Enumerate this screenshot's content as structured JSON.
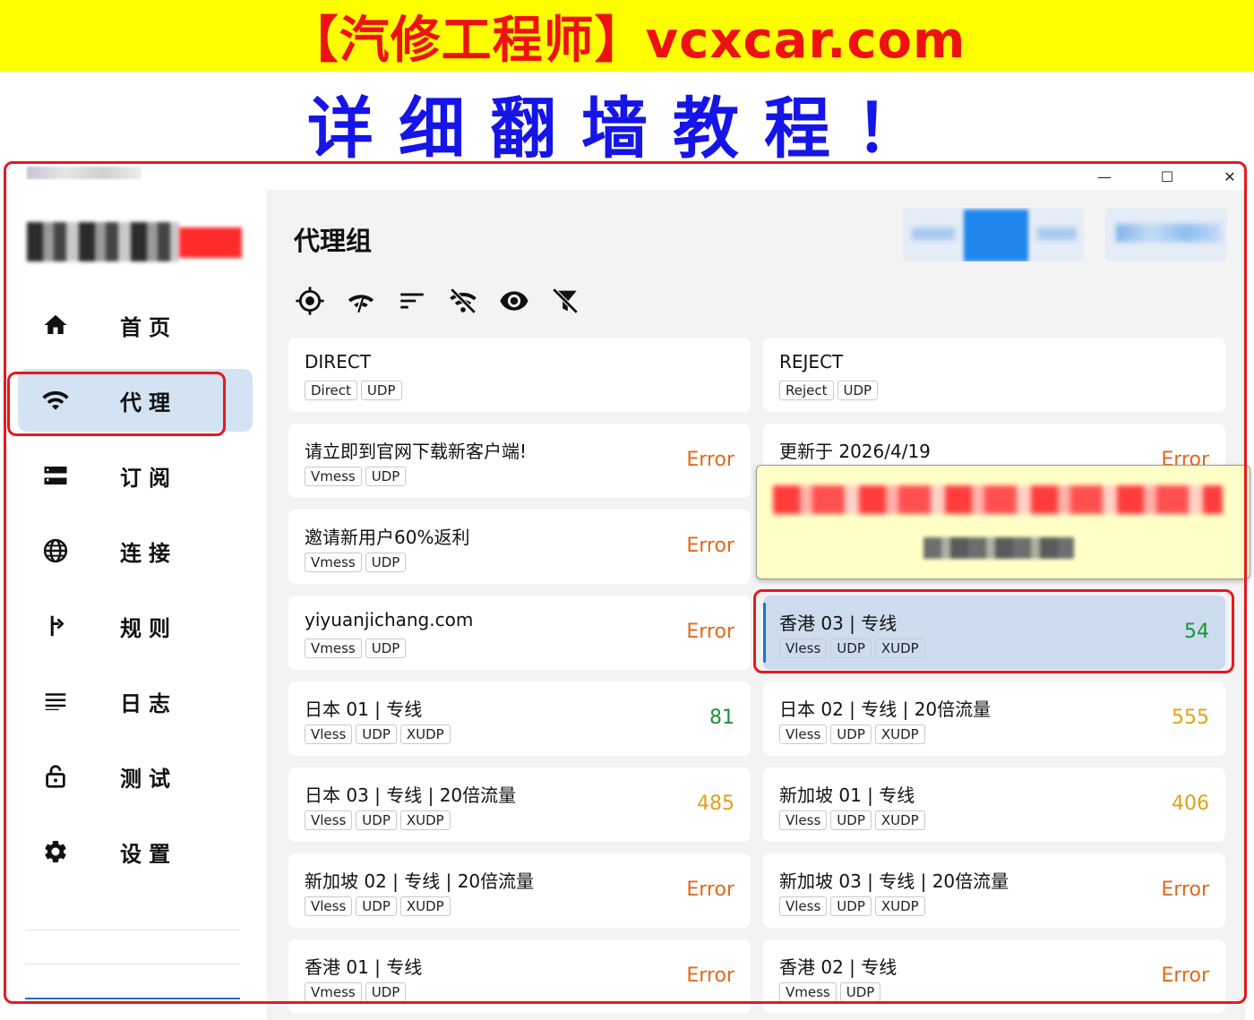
{
  "banner": {
    "title": "【汽修工程师】vcxcar.com",
    "subtitle": "详细翻墙教程！"
  },
  "window": {
    "minimize_glyph": "—",
    "maximize_glyph": "☐",
    "close_glyph": "✕"
  },
  "sidebar": {
    "items": [
      {
        "label": "首页",
        "icon": "home-icon"
      },
      {
        "label": "代理",
        "icon": "wifi-icon"
      },
      {
        "label": "订阅",
        "icon": "storage-icon"
      },
      {
        "label": "连接",
        "icon": "globe-icon"
      },
      {
        "label": "规则",
        "icon": "fork-arrow-icon"
      },
      {
        "label": "日志",
        "icon": "lines-icon"
      },
      {
        "label": "测试",
        "icon": "lock-icon"
      },
      {
        "label": "设置",
        "icon": "gear-icon"
      }
    ],
    "active_index": 1
  },
  "main": {
    "title": "代理组",
    "toolbar": [
      "locate-icon",
      "speed-test-icon",
      "sort-icon",
      "wifi-off-icon",
      "eye-icon",
      "filter-off-icon"
    ]
  },
  "proxies": [
    {
      "name": "DIRECT",
      "tags": [
        "Direct",
        "UDP"
      ],
      "delay": ""
    },
    {
      "name": "REJECT",
      "tags": [
        "Reject",
        "UDP"
      ],
      "delay": ""
    },
    {
      "name": "请立即到官网下载新客户端!",
      "tags": [
        "Vmess",
        "UDP"
      ],
      "delay": "Error",
      "status": "err"
    },
    {
      "name": "更新于 2026/4/19",
      "tags": [],
      "delay": "Error",
      "status": "err"
    },
    {
      "name": "邀请新用户60%返利",
      "tags": [
        "Vmess",
        "UDP"
      ],
      "delay": "Error",
      "status": "err"
    },
    {
      "name": "",
      "tags": [],
      "delay": ""
    },
    {
      "name": "yiyuanjichang.com",
      "tags": [
        "Vmess",
        "UDP"
      ],
      "delay": "Error",
      "status": "err"
    },
    {
      "name": "香港 03 | 专线",
      "tags": [
        "Vless",
        "UDP",
        "XUDP"
      ],
      "delay": "54",
      "status": "good"
    },
    {
      "name": "日本 01 | 专线",
      "tags": [
        "Vless",
        "UDP",
        "XUDP"
      ],
      "delay": "81",
      "status": "good"
    },
    {
      "name": "日本 02 | 专线 | 20倍流量",
      "tags": [
        "Vless",
        "UDP",
        "XUDP"
      ],
      "delay": "555",
      "status": "mid"
    },
    {
      "name": "日本 03 | 专线 | 20倍流量",
      "tags": [
        "Vless",
        "UDP",
        "XUDP"
      ],
      "delay": "485",
      "status": "mid"
    },
    {
      "name": "新加坡 01 | 专线",
      "tags": [
        "Vless",
        "UDP",
        "XUDP"
      ],
      "delay": "406",
      "status": "mid"
    },
    {
      "name": "新加坡 02 | 专线 | 20倍流量",
      "tags": [
        "Vless",
        "UDP",
        "XUDP"
      ],
      "delay": "Error",
      "status": "err"
    },
    {
      "name": "新加坡 03 | 专线 | 20倍流量",
      "tags": [
        "Vless",
        "UDP",
        "XUDP"
      ],
      "delay": "Error",
      "status": "err"
    },
    {
      "name": "香港 01 | 专线",
      "tags": [
        "Vmess",
        "UDP"
      ],
      "delay": "Error",
      "status": "err"
    },
    {
      "name": "香港 02 | 专线",
      "tags": [
        "Vmess",
        "UDP"
      ],
      "delay": "Error",
      "status": "err"
    }
  ],
  "selected_index": 7,
  "colors": {
    "accent": "#1f86ee",
    "error": "#e06a1a",
    "good": "#1e8f3c",
    "medium": "#e2a01a",
    "annotation": "#e8181e"
  }
}
